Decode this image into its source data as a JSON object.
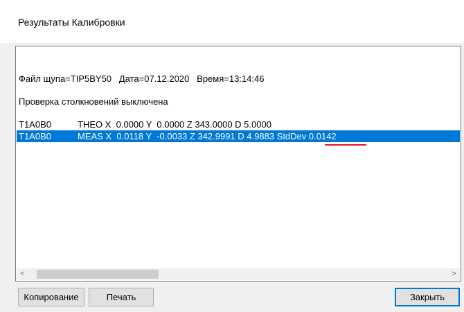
{
  "window": {
    "title": "Результаты Калибровки"
  },
  "results": {
    "header_line": "Файл щупа=TIP5BY50   Дата=07.12.2020   Время=13:14:46",
    "collision_line": "Проверка столкновений выключена",
    "rows": [
      {
        "id": "T1A0B0",
        "values": "THEO X  0.0000 Y  0.0000 Z 343.0000 D 5.0000",
        "selected": false
      },
      {
        "id": "T1A0B0",
        "values": "MEAS X  0.0118 Y  -0.0033 Z 342.9991 D 4.9883 StdDev 0.0142",
        "selected": true
      }
    ]
  },
  "buttons": {
    "copy": "Копирование",
    "print": "Печать",
    "close": "Закрыть"
  },
  "scrollbar": {
    "left_arrow": "<",
    "right_arrow": ">"
  },
  "colors": {
    "selection": "#0078d7",
    "underline": "#e81123"
  }
}
